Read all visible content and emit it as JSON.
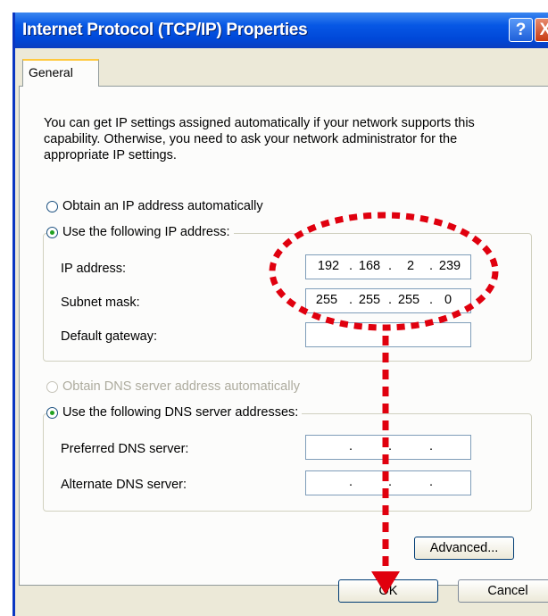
{
  "window": {
    "title": "Internet Protocol (TCP/IP) Properties",
    "help_label": "?",
    "close_label": "X"
  },
  "tab": {
    "label": "General"
  },
  "description": "You can get IP settings assigned automatically if your network supports this capability. Otherwise, you need to ask your network administrator for the appropriate IP settings.",
  "ip_section": {
    "obtain_auto": {
      "label": "Obtain an IP address automatically",
      "selected": false
    },
    "use_following": {
      "label": "Use the following IP address:",
      "selected": true
    },
    "fields": {
      "ip": {
        "label": "IP address:",
        "octets": [
          "192",
          "168",
          "2",
          "239"
        ]
      },
      "subnet": {
        "label": "Subnet mask:",
        "octets": [
          "255",
          "255",
          "255",
          "0"
        ]
      },
      "gateway": {
        "label": "Default gateway:",
        "octets": [
          "",
          "",
          "",
          ""
        ]
      }
    }
  },
  "dns_section": {
    "obtain_auto": {
      "label": "Obtain DNS server address automatically",
      "selected": false,
      "enabled": false
    },
    "use_following": {
      "label": "Use the following DNS server addresses:",
      "selected": true
    },
    "fields": {
      "preferred": {
        "label": "Preferred DNS server:",
        "octets": [
          "",
          "",
          "",
          ""
        ]
      },
      "alternate": {
        "label": "Alternate DNS server:",
        "octets": [
          "",
          "",
          "",
          ""
        ]
      }
    }
  },
  "buttons": {
    "advanced": "Advanced...",
    "ok": "OK",
    "cancel": "Cancel"
  },
  "annotation_color": "#e0000e",
  "octet_separator": "."
}
